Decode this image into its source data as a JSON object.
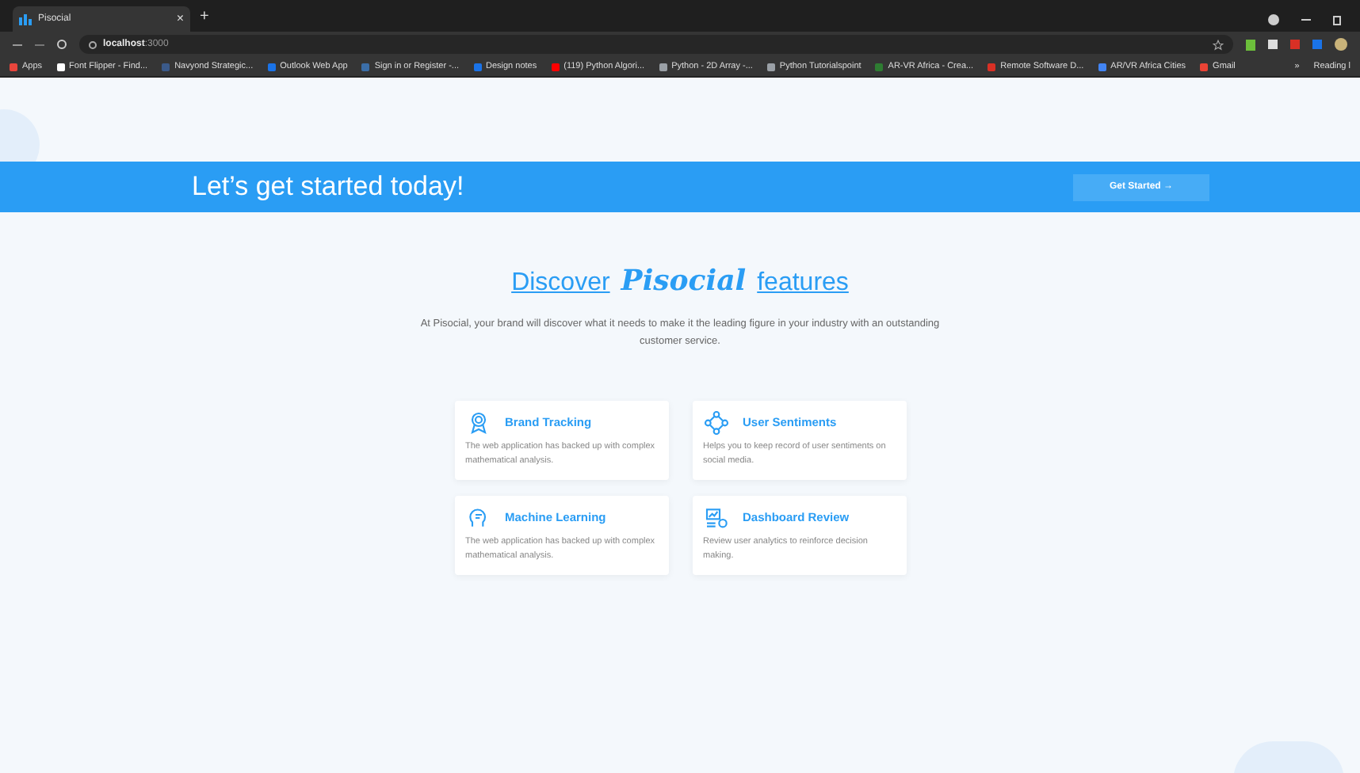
{
  "browser": {
    "tab_title": "Pisocial",
    "new_tab": "+",
    "close_tab": "×",
    "url_host": "localhost",
    "url_port": ":3000",
    "bookmarks": [
      {
        "label": "Apps",
        "color": "#e8453c"
      },
      {
        "label": "Font Flipper - Find...",
        "color": "#ffffff"
      },
      {
        "label": "Navyond Strategic...",
        "color": "#3b5a8a"
      },
      {
        "label": "Outlook Web App",
        "color": "#1a73e8"
      },
      {
        "label": "Sign in or Register -...",
        "color": "#3b6ea8"
      },
      {
        "label": "Design notes",
        "color": "#1a73e8"
      },
      {
        "label": "(119) Python Algori...",
        "color": "#ff0000"
      },
      {
        "label": "Python - 2D Array -...",
        "color": "#9aa0a6"
      },
      {
        "label": "Python Tutorialspoint",
        "color": "#9aa0a6"
      },
      {
        "label": "AR-VR Africa - Crea...",
        "color": "#2e7d32"
      },
      {
        "label": "Remote Software D...",
        "color": "#d93025"
      },
      {
        "label": "AR/VR Africa Cities",
        "color": "#4285f4"
      },
      {
        "label": "Gmail",
        "color": "#ea4335"
      }
    ],
    "more": "»",
    "reading_list": "Reading l"
  },
  "banner": {
    "title": "Let’s get started today!",
    "button": "Get Started →"
  },
  "features": {
    "heading_before": "Discover",
    "brand": "Pisocial",
    "heading_after": "features",
    "description": "At Pisocial, your brand will discover what it needs to make it the leading figure in your industry with an outstanding customer service.",
    "cards": [
      {
        "kind": "badge",
        "title": "Brand Tracking",
        "text": "The web application has backed up with complex mathematical analysis."
      },
      {
        "kind": "network",
        "title": "User Sentiments",
        "text": "Helps you to keep record of user sentiments on social media."
      },
      {
        "kind": "brain",
        "title": "Machine Learning",
        "text": "The web application has backed up with complex mathematical analysis."
      },
      {
        "kind": "dashboard",
        "title": "Dashboard Review",
        "text": "Review user analytics to reinforce decision making."
      }
    ]
  }
}
